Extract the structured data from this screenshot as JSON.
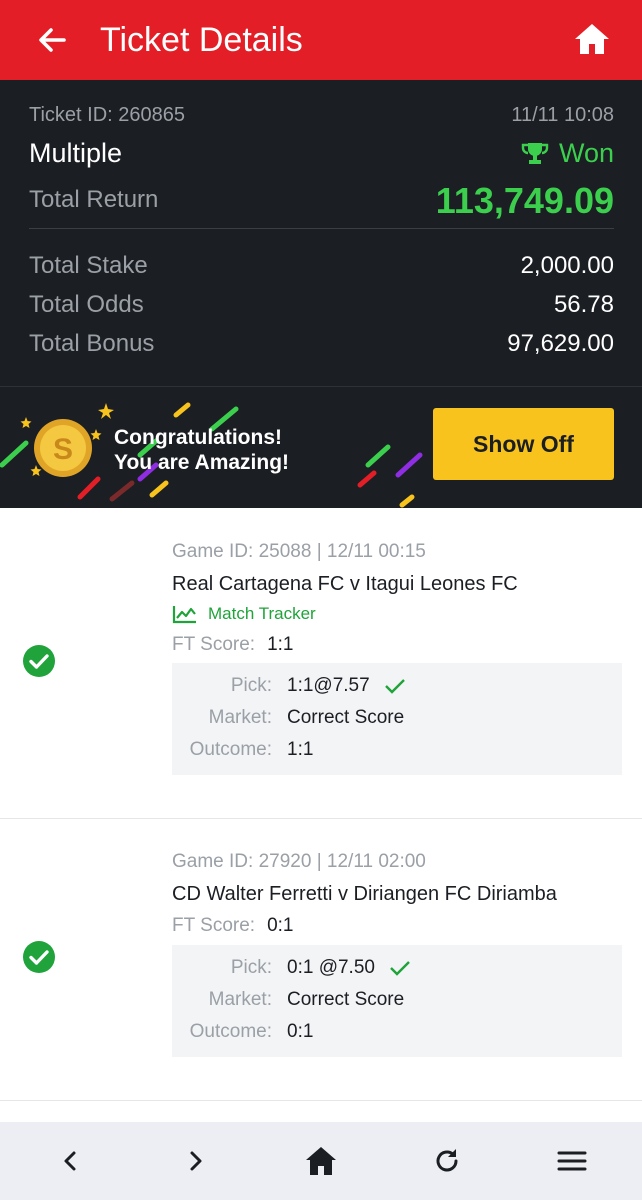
{
  "header": {
    "title": "Ticket Details"
  },
  "summary": {
    "ticket_id_label": "Ticket ID: 260865",
    "datetime": "11/11 10:08",
    "bet_type": "Multiple",
    "status": "Won",
    "total_return_label": "Total Return",
    "total_return": "113,749.09",
    "rows": [
      {
        "label": "Total Stake",
        "value": "2,000.00"
      },
      {
        "label": "Total Odds",
        "value": "56.78"
      },
      {
        "label": "Total Bonus",
        "value": "97,629.00"
      }
    ]
  },
  "banner": {
    "line1": "Congratulations!",
    "line2": "You are Amazing!",
    "button": "Show Off"
  },
  "games": [
    {
      "meta": "Game ID: 25088 | 12/11 00:15",
      "match": "Real Cartagena FC v Itagui Leones FC",
      "tracker": "Match Tracker",
      "ft_label": "FT Score:",
      "ft_value": "1:1",
      "pick_label": "Pick:",
      "pick_value": "1:1@7.57",
      "market_label": "Market:",
      "market_value": "Correct Score",
      "outcome_label": "Outcome:",
      "outcome_value": "1:1"
    },
    {
      "meta": "Game ID: 27920 | 12/11 02:00",
      "match": "CD Walter Ferretti v Diriangen FC Diriamba",
      "ft_label": "FT Score:",
      "ft_value": "0:1",
      "pick_label": "Pick:",
      "pick_value": "0:1 @7.50",
      "market_label": "Market:",
      "market_value": "Correct Score",
      "outcome_label": "Outcome:",
      "outcome_value": "0:1"
    }
  ],
  "colors": {
    "brand_red": "#e41e26",
    "dark_bg": "#1b1e23",
    "won_green": "#3ccf4e",
    "button_yellow": "#f7c31c"
  },
  "icons": [
    "back-arrow-icon",
    "home-icon",
    "trophy-icon",
    "coin-icon",
    "check-circle-icon",
    "tick-icon",
    "chart-icon",
    "chevron-left-icon",
    "chevron-right-icon",
    "refresh-icon",
    "menu-icon"
  ]
}
